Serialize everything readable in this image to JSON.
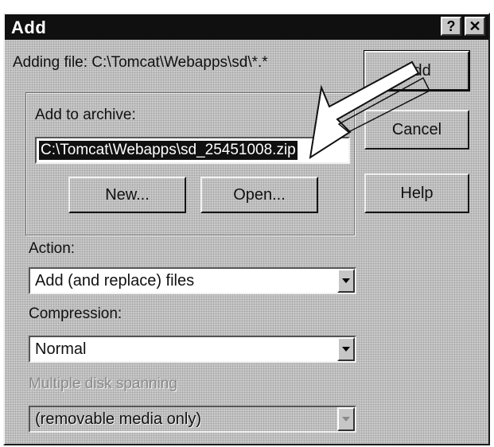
{
  "window": {
    "title": "Add",
    "help_glyph": "?",
    "close_glyph": "✕"
  },
  "adding_file": {
    "label": "Adding file: C:\\Tomcat\\Webapps\\sd\\*.*"
  },
  "archive": {
    "label": "Add to archive:",
    "value": "C:\\Tomcat\\Webapps\\sd_25451008.zip",
    "new_button": "New...",
    "open_button": "Open..."
  },
  "buttons": {
    "add": "Add",
    "cancel": "Cancel",
    "help": "Help"
  },
  "action": {
    "label": "Action:",
    "value": "Add (and replace) files"
  },
  "compression": {
    "label": "Compression:",
    "value": "Normal"
  },
  "spanning": {
    "label": "Multiple disk spanning",
    "value": "(removable media only)"
  },
  "icons": [
    "help-icon",
    "close-icon",
    "dropdown-arrow-icon",
    "annotation-arrow-icon"
  ]
}
